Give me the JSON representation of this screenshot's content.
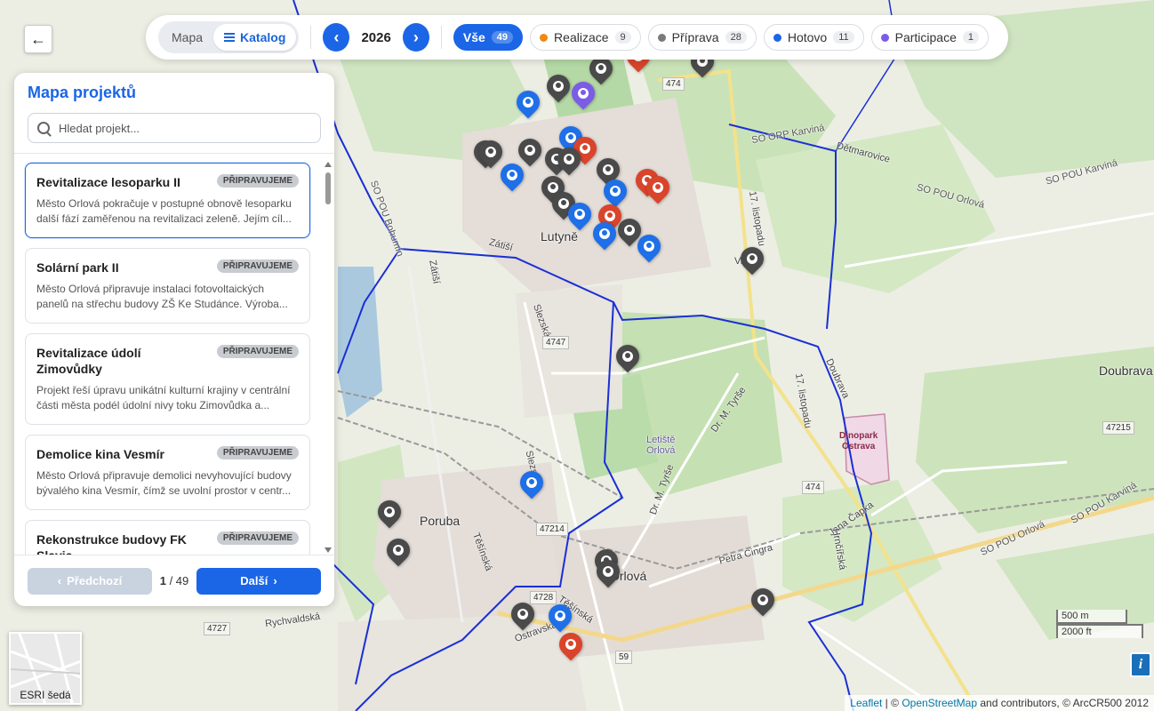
{
  "topbar": {
    "view_map": "Mapa",
    "view_catalog": "Katalog",
    "year": "2026",
    "filters": [
      {
        "label": "Vše",
        "count": "49",
        "color": "",
        "active": true
      },
      {
        "label": "Realizace",
        "count": "9",
        "color": "#f08a10",
        "active": false
      },
      {
        "label": "Příprava",
        "count": "28",
        "color": "#7a7a7a",
        "active": false
      },
      {
        "label": "Hotovo",
        "count": "11",
        "color": "#1a66e6",
        "active": false
      },
      {
        "label": "Participace",
        "count": "1",
        "color": "#7b5ce6",
        "active": false
      }
    ]
  },
  "panel": {
    "title": "Mapa projektů",
    "search_placeholder": "Hledat projekt...",
    "projects": [
      {
        "title": "Revitalizace lesoparku II",
        "status": "PŘIPRAVUJEME",
        "desc": "Město Orlová pokračuje v postupné obnově lesoparku další fází zaměřenou na revitalizaci zeleně. Jejím cíl..."
      },
      {
        "title": "Solární park II",
        "status": "PŘIPRAVUJEME",
        "desc": "Město Orlová připravuje instalaci fotovoltaických panelů na střechu budovy ZŠ Ke Studánce. Výroba..."
      },
      {
        "title": "Revitalizace údolí Zimovůdky",
        "status": "PŘIPRAVUJEME",
        "desc": "Projekt řeší úpravu unikátní kulturní krajiny v centrální části města podél údolní nivy toku Zimovůdka a..."
      },
      {
        "title": "Demolice kina Vesmír",
        "status": "PŘIPRAVUJEME",
        "desc": "Město Orlová připravuje demolici nevyhovující budovy bývalého kina Vesmír, čímž se uvolní prostor v centr..."
      },
      {
        "title": "Rekonstrukce budovy FK Slavia",
        "status": "PŘIPRAVUJEME",
        "desc": ""
      }
    ],
    "pager": {
      "prev": "Předchozí",
      "page_current": "1",
      "page_total": "/ 49",
      "next": "Další"
    }
  },
  "map": {
    "labels": {
      "lutyne": "Lutyně",
      "poruba": "Poruba",
      "doubrava": "Doubrava",
      "vrbice": "Vrbice",
      "letiste": "Letiště",
      "orlova_small": "Orlová",
      "orlova": "Orlová",
      "detmarovice": "Dětmarovice",
      "so_orp_karvina": "SO ORP Karviná",
      "so_pou_karvina": "SO POU Karviná",
      "so_pou_orlova": "SO POU Orlová",
      "so_pou_bohumin": "SO POU Bohumín",
      "so_orp_bohumin": "SO ORP Bohumín",
      "listopadu": "17. listopadu",
      "listopadu2": "17. listopadu",
      "zatisi": "Zátiší",
      "zatisi2": "Zátiší",
      "slezska": "Slezská",
      "slezska2": "Slezská",
      "dr_tyrse": "Dr. M. Tyrše",
      "dr_tyrse2": "Dr. M. Tyrše",
      "teslinska": "Těšínská",
      "teslinska2": "Těšínská",
      "rychvaldska": "Rychvaldská",
      "petra_cingra": "Petra Cingra",
      "jana_capka": "Jana Čapka",
      "hrnecka": "Hrnčířská",
      "ostravska": "Ostravská",
      "doubrava_road": "Doubrava",
      "dinopark_line1": "Dinopark",
      "dinopark_line2": "Ostrava"
    },
    "road_numbers": [
      "474",
      "4747",
      "47214",
      "4728",
      "474",
      "47215",
      "4727",
      "59",
      "47"
    ],
    "marker_legend": {
      "grey": "Příprava",
      "blue": "Hotovo",
      "red": "Realizace",
      "purple": "Participace"
    }
  },
  "layer_switch": {
    "label": "ESRI šedá"
  },
  "scale": {
    "metric": "500 m",
    "imperial": "2000 ft"
  },
  "info_label": "i",
  "attribution": {
    "leaflet": "Leaflet",
    "sep": "| ©",
    "osm": "OpenStreetMap",
    "rest": "and contributors, © ArcCR500 2012"
  }
}
